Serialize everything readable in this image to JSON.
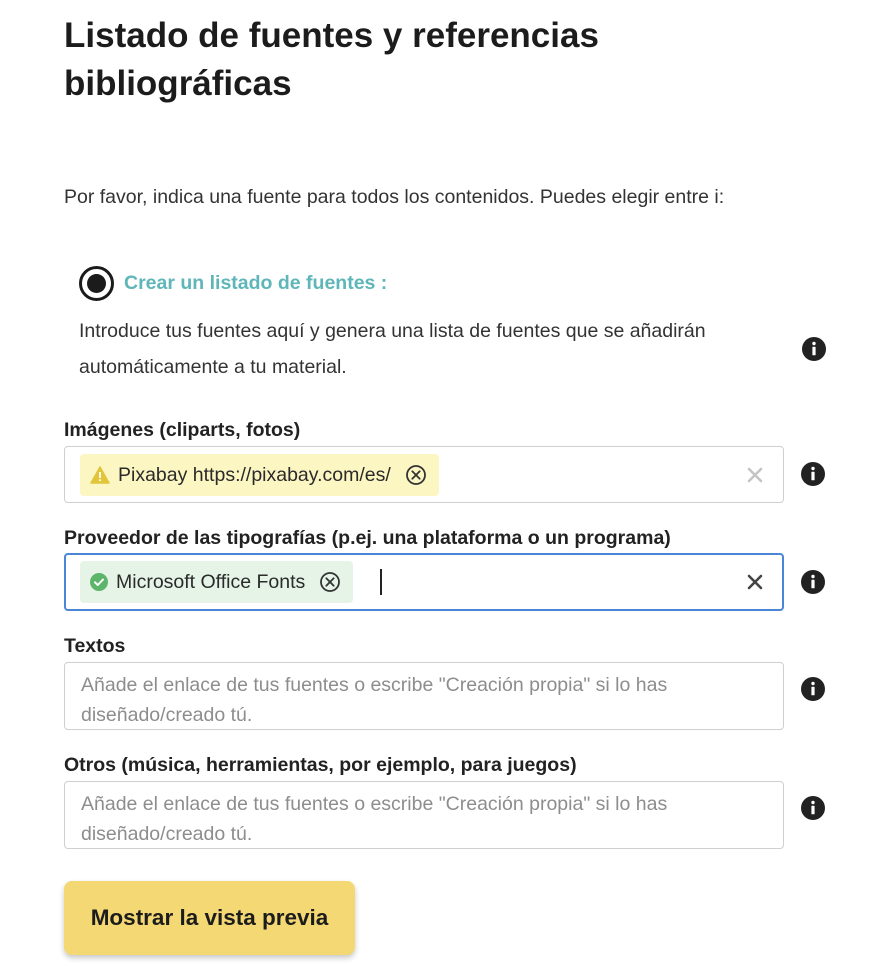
{
  "page": {
    "title": "Listado de fuentes y referencias bibliográficas",
    "intro": "Por favor, indica una fuente para todos los contenidos. Puedes elegir entre i:"
  },
  "option": {
    "label": "Crear un listado de fuentes :",
    "description": "Introduce tus fuentes aquí y genera una lista de fuentes que se añadirán automáticamente a tu material.",
    "selected": true,
    "icon": "info-icon"
  },
  "fields": {
    "images": {
      "label": "Imágenes (cliparts, fotos)",
      "tag": "Pixabay https://pixabay.com/es/",
      "tag_status": "warning",
      "icons": [
        "warning-icon",
        "remove-tag-icon",
        "clear-icon",
        "info-icon"
      ]
    },
    "fonts": {
      "label": "Proveedor de las tipografías (p.ej. una plataforma o un programa)",
      "tag": "Microsoft Office Fonts",
      "tag_status": "valid",
      "icons": [
        "check-circle-icon",
        "remove-tag-icon",
        "clear-icon",
        "info-icon"
      ]
    },
    "texts": {
      "label": "Textos",
      "placeholder": "Añade el enlace de tus fuentes o escribe \"Creación propia\" si lo has diseñado/creado tú."
    },
    "others": {
      "label": "Otros (música, herramientas, por ejemplo, para juegos)",
      "placeholder": "Añade el enlace de tus fuentes o escribe \"Creación propia\" si lo has diseñado/creado tú."
    }
  },
  "actions": {
    "preview_label": "Mostrar la vista previa"
  },
  "colors": {
    "accent_teal": "#5fb6b8",
    "warning_tag_bg": "#fcf6c2",
    "warning_icon": "#e2c53a",
    "valid_tag_bg": "#e6f4e8",
    "valid_icon": "#5cb56a",
    "focus_border": "#4a86d8",
    "button_bg": "#f3d873"
  }
}
